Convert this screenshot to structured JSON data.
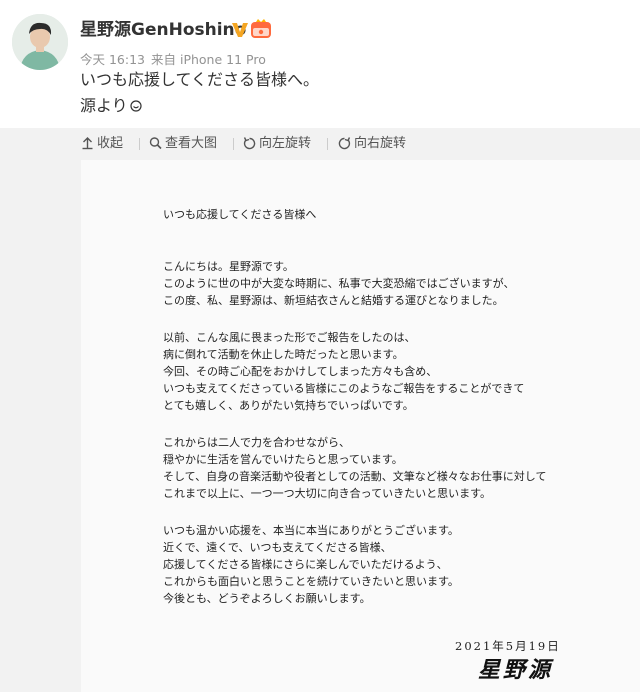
{
  "post": {
    "username": "星野源GenHoshino",
    "time": "今天 16:13",
    "source": "来自 iPhone 11 Pro",
    "text_line1": "いつも応援してくださる皆様へ。",
    "text_line2": "源より"
  },
  "icons": {
    "avatar": "avatar",
    "verified": "verified-v-icon",
    "member": "member-badge-icon",
    "smile": "smile-icon",
    "collapse": "collapse-up-icon",
    "view": "magnifier-icon",
    "rotate_left": "rotate-left-icon",
    "rotate_right": "rotate-right-icon"
  },
  "colors": {
    "verified": "#f5a623",
    "member": "#ff6a3d",
    "meta_text": "#939393",
    "toolbar_bg": "#f2f2f2"
  },
  "toolbar": {
    "collapse": "收起",
    "view_full": "查看大图",
    "rotate_left": "向左旋转",
    "rotate_right": "向右旋转"
  },
  "letter": {
    "greeting": "いつも応援してくださる皆様へ",
    "lines": [
      "こんにちは。星野源です。",
      "このように世の中が大変な時期に、私事で大変恐縮ではございますが、",
      "この度、私、星野源は、新垣結衣さんと結婚する運びとなりました。",
      "以前、こんな風に畏まった形でご報告をしたのは、",
      "病に倒れて活動を休止した時だったと思います。",
      "今回、その時ご心配をおかけしてしまった方々も含め、",
      "いつも支えてくださっている皆様にこのようなご報告をすることができて",
      "とても嬉しく、ありがたい気持ちでいっぱいです。",
      "これからは二人で力を合わせながら、",
      "穏やかに生活を営んでいけたらと思っています。",
      "そして、自身の音楽活動や役者としての活動、文筆など様々なお仕事に対して",
      "これまで以上に、一つ一つ大切に向き合っていきたいと思います。",
      "いつも温かい応援を、本当に本当にありがとうございます。",
      "近くで、遠くで、いつも支えてくださる皆様、",
      "応援してくださる皆様にさらに楽しんでいただけるよう、",
      "これからも面白いと思うことを続けていきたいと思います。",
      "今後とも、どうぞよろしくお願いします。"
    ],
    "date": "2021年5月19日",
    "signature": "星野源"
  }
}
